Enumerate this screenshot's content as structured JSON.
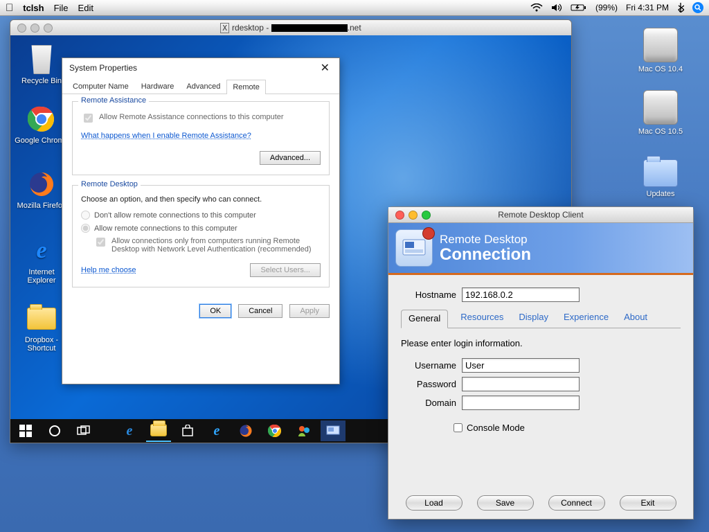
{
  "menubar": {
    "app": "tclsh",
    "menus": [
      "File",
      "Edit"
    ],
    "battery": "(99%)",
    "clock": "Fri 4:31 PM"
  },
  "mac_desktop": [
    {
      "kind": "drive",
      "label": "Mac OS 10.4"
    },
    {
      "kind": "drive",
      "label": "Mac OS 10.5"
    },
    {
      "kind": "folder",
      "label": "Updates"
    }
  ],
  "xwin": {
    "title_prefix": "rdesktop - ",
    "title_suffix": ".net"
  },
  "win_icons": [
    {
      "kind": "recycle",
      "label": "Recycle Bin"
    },
    {
      "kind": "chrome",
      "label": "Google Chrome"
    },
    {
      "kind": "firefox",
      "label": "Mozilla Firefox"
    },
    {
      "kind": "ie",
      "label": "Internet Explorer"
    },
    {
      "kind": "folder",
      "label": "Dropbox - Shortcut"
    }
  ],
  "sysprop": {
    "title": "System Properties",
    "tabs": [
      "Computer Name",
      "Hardware",
      "Advanced",
      "Remote"
    ],
    "active_tab": 3,
    "ra_legend": "Remote Assistance",
    "ra_checkbox": "Allow Remote Assistance connections to this computer",
    "ra_link": "What happens when I enable Remote Assistance?",
    "ra_advanced": "Advanced...",
    "rd_legend": "Remote Desktop",
    "rd_intro": "Choose an option, and then specify who can connect.",
    "rd_opt1": "Don't allow remote connections to this computer",
    "rd_opt2": "Allow remote connections to this computer",
    "rd_nla": "Allow connections only from computers running Remote Desktop with Network Level Authentication (recommended)",
    "help_link": "Help me choose",
    "select_users": "Select Users...",
    "ok": "OK",
    "cancel": "Cancel",
    "apply": "Apply"
  },
  "rdc": {
    "window_title": "Remote Desktop Client",
    "banner1": "Remote Desktop",
    "banner2": "Connection",
    "hostname_label": "Hostname",
    "hostname_value": "192.168.0.2",
    "tabs": [
      "General",
      "Resources",
      "Display",
      "Experience",
      "About"
    ],
    "active_tab": 0,
    "prompt": "Please enter login information.",
    "username_label": "Username",
    "username_value": "User",
    "password_label": "Password",
    "password_value": "",
    "domain_label": "Domain",
    "domain_value": "",
    "console_label": "Console Mode",
    "buttons": [
      "Load",
      "Save",
      "Connect",
      "Exit"
    ]
  }
}
